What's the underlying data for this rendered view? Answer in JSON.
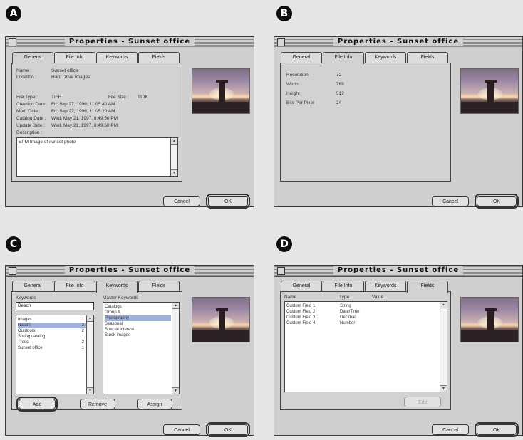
{
  "labels": {
    "a": "A",
    "b": "B",
    "c": "C",
    "d": "D"
  },
  "window_title": "Properties - Sunset office",
  "tabs": [
    "General",
    "File Info",
    "Keywords",
    "Fields"
  ],
  "buttons": {
    "cancel": "Cancel",
    "ok": "OK",
    "add": "Add",
    "remove": "Remove",
    "assign": "Assign",
    "edit": "Edit"
  },
  "general": {
    "name_label": "Name :",
    "name_value": "Sunset office",
    "location_label": "Location :",
    "location_value": "Hard Drive Images",
    "filetype_label": "File Type :",
    "filetype_value": "TIFF",
    "filesize_label": "File Size :",
    "filesize_value": "110K",
    "creation_label": "Creation Date :",
    "creation_value": "Fri, Sep 27, 1996, 11:05:40 AM",
    "mod_label": "Mod. Date :",
    "mod_value": "Fri, Sep 27, 1996, 11:05:20 AM",
    "catalog_label": "Catalog Date :",
    "catalog_value": "Wed, May 21, 1997, 8:49:50 PM",
    "update_label": "Update Date :",
    "update_value": "Wed, May 21, 1997, 8:49:50 PM",
    "description_label": "Description :",
    "description_value": "EPM Image of sunset photo"
  },
  "fileinfo": {
    "resolution_label": "Resolution",
    "resolution_value": "72",
    "width_label": "Width",
    "width_value": "768",
    "height_label": "Height",
    "height_value": "512",
    "bits_label": "Bits Per Pixel",
    "bits_value": "24"
  },
  "keywords": {
    "keywords_label": "Keywords",
    "search_value": "Beach",
    "list": [
      {
        "name": "Images",
        "count": "11"
      },
      {
        "name": "Nature",
        "count": "2"
      },
      {
        "name": "Outdoors",
        "count": "2"
      },
      {
        "name": "Spring catalog",
        "count": "1"
      },
      {
        "name": "Trees",
        "count": "2"
      },
      {
        "name": "Sunset office",
        "count": "1"
      }
    ],
    "master_label": "Master Keywords",
    "master": [
      "Catalogs",
      "Group A",
      "Photography",
      "Seasonal",
      "Special interest",
      "Stock images"
    ]
  },
  "fields": {
    "col_name": "Name",
    "col_type": "Type",
    "col_value": "Value",
    "rows": [
      {
        "name": "Custom Field 1",
        "type": "String"
      },
      {
        "name": "Custom Field 2",
        "type": "Date/Time"
      },
      {
        "name": "Custom Field 3",
        "type": "Decimal"
      },
      {
        "name": "Custom Field 4",
        "type": "Number"
      }
    ]
  },
  "icons": {
    "close": "close-box-icon",
    "scroll_up": "scroll-up-arrow-icon",
    "scroll_down": "scroll-down-arrow-icon"
  }
}
